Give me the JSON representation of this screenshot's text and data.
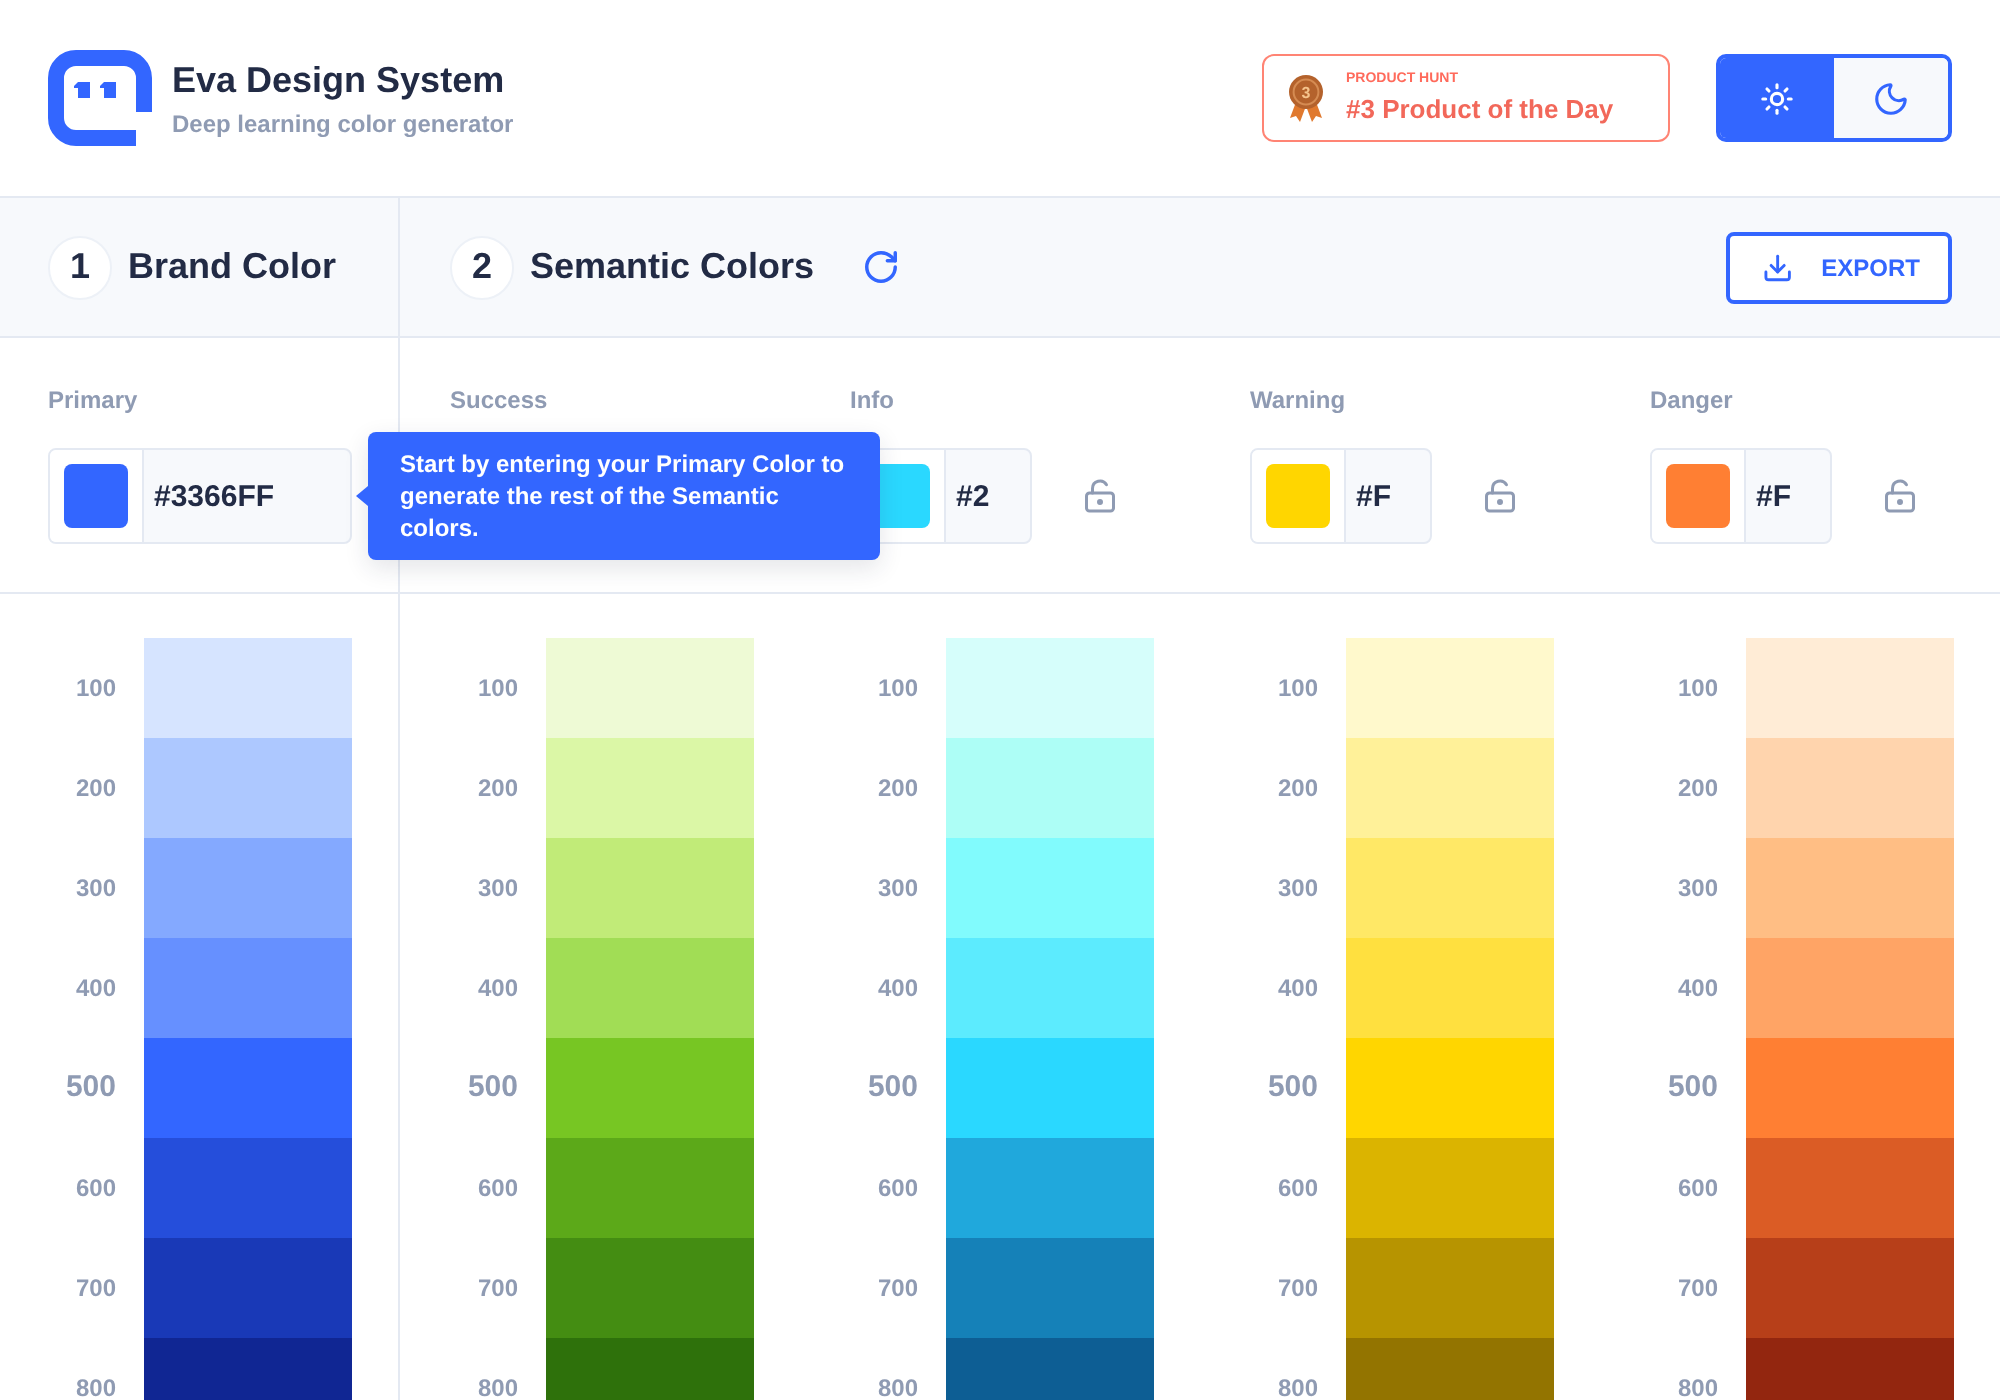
{
  "header": {
    "title": "Eva Design System",
    "subtitle": "Deep learning color generator"
  },
  "badge": {
    "kicker": "PRODUCT HUNT",
    "title": "#3 Product of the Day",
    "medal": "3"
  },
  "theme_toggle": [
    {
      "kind": "light",
      "selected": true
    },
    {
      "kind": "dark",
      "selected": false
    }
  ],
  "steps": [
    {
      "number": "1",
      "title": "Brand Color"
    },
    {
      "number": "2",
      "title": "Semantic Colors"
    }
  ],
  "export_button": {
    "label": "EXPORT"
  },
  "tooltip": "Start by entering your Primary Color to generate the rest of the Semantic colors.",
  "palettes": [
    {
      "kind": "brand",
      "label": "Primary",
      "input": {
        "value": "#3366FF",
        "color": "#3366ff"
      },
      "shades": [
        {
          "label": "100",
          "base": false,
          "color": "#d6e4ff"
        },
        {
          "label": "200",
          "base": false,
          "color": "#adc8ff"
        },
        {
          "label": "300",
          "base": false,
          "color": "#84a9ff"
        },
        {
          "label": "400",
          "base": false,
          "color": "#6690ff"
        },
        {
          "label": "500",
          "base": true,
          "color": "#3366ff"
        },
        {
          "label": "600",
          "base": false,
          "color": "#254edb"
        },
        {
          "label": "700",
          "base": false,
          "color": "#1939b7"
        },
        {
          "label": "800",
          "base": false,
          "color": "#102693"
        }
      ]
    },
    {
      "kind": "semantic",
      "label": "Success",
      "shades": [
        {
          "label": "100",
          "base": false,
          "color": "#eefad5"
        },
        {
          "label": "200",
          "base": false,
          "color": "#dbf7a6"
        },
        {
          "label": "300",
          "base": false,
          "color": "#c1eb78"
        },
        {
          "label": "400",
          "base": false,
          "color": "#a1dd55"
        },
        {
          "label": "500",
          "base": true,
          "color": "#77c623"
        },
        {
          "label": "600",
          "base": false,
          "color": "#5ca919"
        },
        {
          "label": "700",
          "base": false,
          "color": "#448d12"
        },
        {
          "label": "800",
          "base": false,
          "color": "#2e710b"
        }
      ]
    },
    {
      "kind": "semantic",
      "label": "Info",
      "input": {
        "value": "#2",
        "color": "#2ad8ff"
      },
      "lock": {
        "locked": false
      },
      "shades": [
        {
          "label": "100",
          "base": false,
          "color": "#d6fefb"
        },
        {
          "label": "200",
          "base": false,
          "color": "#adfef6"
        },
        {
          "label": "300",
          "base": false,
          "color": "#81fbfd"
        },
        {
          "label": "400",
          "base": false,
          "color": "#5cebfe"
        },
        {
          "label": "500",
          "base": true,
          "color": "#2ad8ff"
        },
        {
          "label": "600",
          "base": false,
          "color": "#20a8dc"
        },
        {
          "label": "700",
          "base": false,
          "color": "#1581b8"
        },
        {
          "label": "800",
          "base": false,
          "color": "#0d5e94"
        }
      ]
    },
    {
      "kind": "semantic",
      "label": "Warning",
      "input": {
        "value": "#F",
        "color": "#ffd600"
      },
      "lock": {
        "locked": false
      },
      "shades": [
        {
          "label": "100",
          "base": false,
          "color": "#fff9cc"
        },
        {
          "label": "200",
          "base": false,
          "color": "#fff199"
        },
        {
          "label": "300",
          "base": false,
          "color": "#ffe866"
        },
        {
          "label": "400",
          "base": false,
          "color": "#ffe03f"
        },
        {
          "label": "500",
          "base": true,
          "color": "#ffd600"
        },
        {
          "label": "600",
          "base": false,
          "color": "#dbb400"
        },
        {
          "label": "700",
          "base": false,
          "color": "#b79400"
        },
        {
          "label": "800",
          "base": false,
          "color": "#937400"
        }
      ]
    },
    {
      "kind": "semantic",
      "label": "Danger",
      "input": {
        "value": "#F",
        "color": "#ff7f33"
      },
      "lock": {
        "locked": false
      },
      "shades": [
        {
          "label": "100",
          "base": false,
          "color": "#ffecd6"
        },
        {
          "label": "200",
          "base": false,
          "color": "#ffd4ad"
        },
        {
          "label": "300",
          "base": false,
          "color": "#ffbe84"
        },
        {
          "label": "400",
          "base": false,
          "color": "#ffa465"
        },
        {
          "label": "500",
          "base": true,
          "color": "#ff7f33"
        },
        {
          "label": "600",
          "base": false,
          "color": "#db5c25"
        },
        {
          "label": "700",
          "base": false,
          "color": "#b73f19"
        },
        {
          "label": "800",
          "base": false,
          "color": "#93260f"
        }
      ]
    }
  ]
}
